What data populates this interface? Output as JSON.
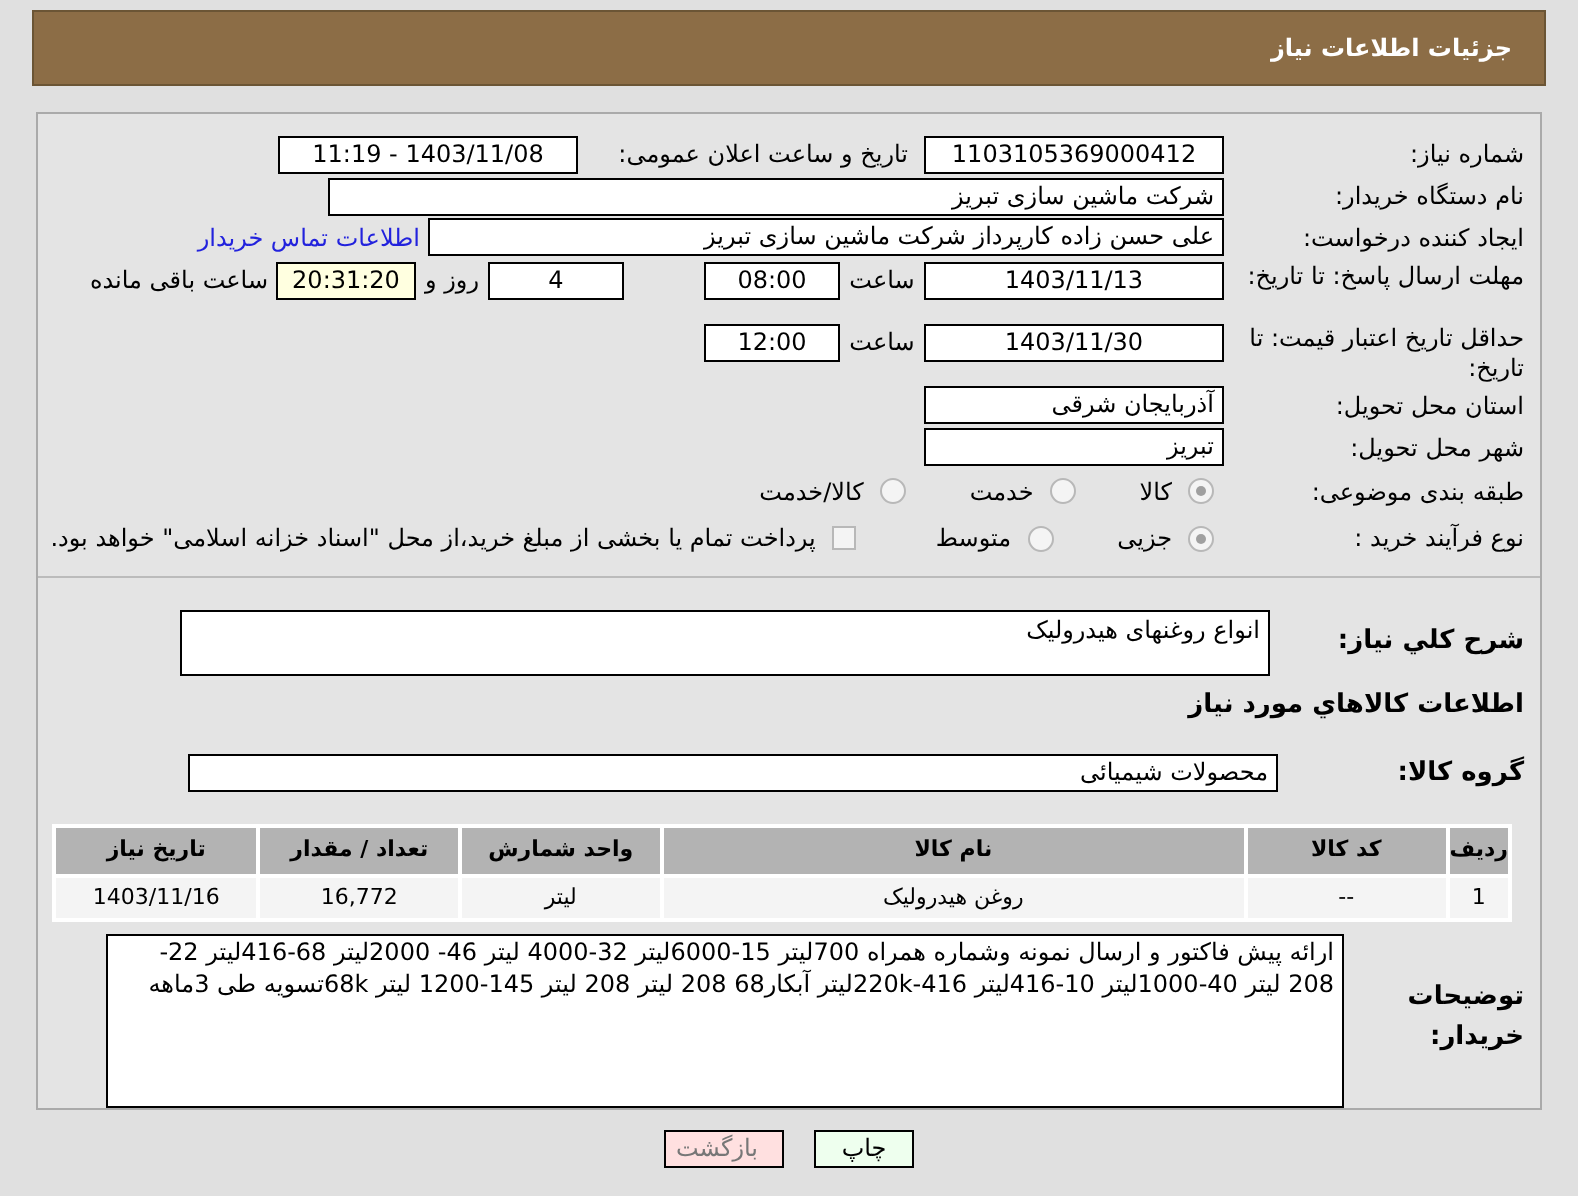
{
  "header": {
    "title": "جزئیات اطلاعات نیاز"
  },
  "need_number": {
    "label": "شماره نیاز:",
    "value": "1103105369000412"
  },
  "announce_date": {
    "label": "تاریخ و ساعت اعلان عمومی:",
    "value": "1403/11/08 - 11:19"
  },
  "buyer_org": {
    "label": "نام دستگاه خریدار:",
    "value": "شرکت ماشین سازی تبریز"
  },
  "requester": {
    "label": "ایجاد کننده درخواست:",
    "value": "علی حسن زاده کارپرداز شرکت ماشین سازی تبریز",
    "link": "اطلاعات تماس خریدار"
  },
  "reply_deadline": {
    "label": "مهلت ارسال پاسخ: تا تاریخ:",
    "date": "1403/11/13",
    "time_label": "ساعت",
    "time": "08:00",
    "days": "4",
    "days_label": "روز و",
    "remaining": "20:31:20",
    "remaining_label": "ساعت باقی مانده"
  },
  "price_validity": {
    "label": "حداقل تاریخ اعتبار قیمت: تا تاریخ:",
    "date": "1403/11/30",
    "time_label": "ساعت",
    "time": "12:00"
  },
  "province": {
    "label": "استان محل تحویل:",
    "value": "آذربایجان شرقی"
  },
  "city": {
    "label": "شهر محل تحویل:",
    "value": "تبریز"
  },
  "category": {
    "label": "طبقه بندی موضوعی:",
    "options": [
      {
        "label": "کالا",
        "selected": true
      },
      {
        "label": "خدمت",
        "selected": false
      },
      {
        "label": "کالا/خدمت",
        "selected": false
      }
    ]
  },
  "process": {
    "label": "نوع فرآیند خرید :",
    "options": [
      {
        "label": "جزیی",
        "selected": true
      },
      {
        "label": "متوسط",
        "selected": false
      }
    ],
    "treasury": {
      "label": "پرداخت تمام یا بخشی از مبلغ خرید،از محل \"اسناد خزانه اسلامی\" خواهد بود.",
      "checked": false
    }
  },
  "summary": {
    "label": "شرح کلي نياز:",
    "value": "انواع روغنهای هیدرولیک"
  },
  "goods_heading": "اطلاعات کالاهاي مورد نياز",
  "goods_group": {
    "label": "گروه کالا:",
    "value": "محصولات شیمیائی"
  },
  "table": {
    "columns": [
      "ردیف",
      "کد کالا",
      "نام کالا",
      "واحد شمارش",
      "تعداد / مقدار",
      "تاریخ نیاز"
    ],
    "rows": [
      [
        "1",
        "--",
        "روغن هیدرولیک",
        "لیتر",
        "16,772",
        "1403/11/16"
      ]
    ]
  },
  "buyer_notes": {
    "label": "توضیحات خریدار:",
    "value": "ارائه پیش فاکتور و ارسال نمونه وشماره همراه 700لیتر 15-6000لیتر 32-4000 لیتر 46- 2000لیتر 68-416لیتر 22-208 لیتر 40-1000لیتر 10-416لیتر 416-220kلیتر آبکار68 208 لیتر 208 لیتر 145-1200 لیتر 68kتسویه طی 3ماهه"
  },
  "buttons": [
    {
      "label": "چاپ",
      "kind": "print"
    },
    {
      "label": "بازگشت",
      "kind": "back"
    }
  ]
}
